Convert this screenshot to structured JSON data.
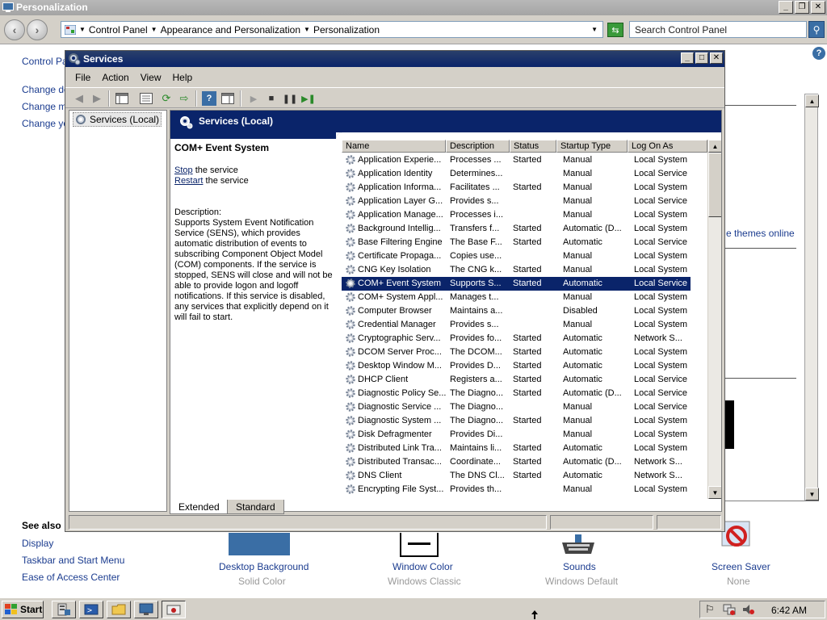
{
  "bg_window": {
    "title": "Personalization",
    "breadcrumb": [
      "Control Panel",
      "Appearance and Personalization",
      "Personalization"
    ],
    "search_placeholder": "Search Control Panel",
    "left_links": [
      "Control Panel Home",
      "Change desktop icons",
      "Change mouse pointers",
      "Change your account picture"
    ],
    "left_links_visible": [
      "Control Par",
      "Change de",
      "Change mo",
      "Change yo"
    ],
    "themes_link": "e themes online",
    "see_also": {
      "heading": "See also",
      "links": [
        "Display",
        "Taskbar and Start Menu",
        "Ease of Access Center"
      ]
    },
    "bottom_items": [
      {
        "label": "Desktop Background",
        "sub": "Solid Color"
      },
      {
        "label": "Window Color",
        "sub": "Windows Classic"
      },
      {
        "label": "Sounds",
        "sub": "Windows Default"
      },
      {
        "label": "Screen Saver",
        "sub": "None"
      }
    ]
  },
  "services": {
    "title": "Services",
    "menu": [
      "File",
      "Action",
      "View",
      "Help"
    ],
    "tree_node": "Services (Local)",
    "header": "Services (Local)",
    "selected_name": "COM+ Event System",
    "stop_link": "Stop",
    "stop_rest": " the service",
    "restart_link": "Restart",
    "restart_rest": " the service",
    "description_label": "Description:",
    "description": "Supports System Event Notification Service (SENS), which provides automatic distribution of events to subscribing Component Object Model (COM) components. If the service is stopped, SENS will close and will not be able to provide logon and logoff notifications. If this service is disabled, any services that explicitly depend on it will fail to start.",
    "columns": [
      "Name",
      "Description",
      "Status",
      "Startup Type",
      "Log On As"
    ],
    "rows": [
      [
        "Application Experie...",
        "Processes ...",
        "Started",
        "Manual",
        "Local System"
      ],
      [
        "Application Identity",
        "Determines...",
        "",
        "Manual",
        "Local Service"
      ],
      [
        "Application Informa...",
        "Facilitates ...",
        "Started",
        "Manual",
        "Local System"
      ],
      [
        "Application Layer G...",
        "Provides s...",
        "",
        "Manual",
        "Local Service"
      ],
      [
        "Application Manage...",
        "Processes i...",
        "",
        "Manual",
        "Local System"
      ],
      [
        "Background Intellig...",
        "Transfers f...",
        "Started",
        "Automatic (D...",
        "Local System"
      ],
      [
        "Base Filtering Engine",
        "The Base F...",
        "Started",
        "Automatic",
        "Local Service"
      ],
      [
        "Certificate Propaga...",
        "Copies use...",
        "",
        "Manual",
        "Local System"
      ],
      [
        "CNG Key Isolation",
        "The CNG k...",
        "Started",
        "Manual",
        "Local System"
      ],
      [
        "COM+ Event System",
        "Supports S...",
        "Started",
        "Automatic",
        "Local Service"
      ],
      [
        "COM+ System Appl...",
        "Manages t...",
        "",
        "Manual",
        "Local System"
      ],
      [
        "Computer Browser",
        "Maintains a...",
        "",
        "Disabled",
        "Local System"
      ],
      [
        "Credential Manager",
        "Provides s...",
        "",
        "Manual",
        "Local System"
      ],
      [
        "Cryptographic Serv...",
        "Provides fo...",
        "Started",
        "Automatic",
        "Network S..."
      ],
      [
        "DCOM Server Proc...",
        "The DCOM...",
        "Started",
        "Automatic",
        "Local System"
      ],
      [
        "Desktop Window M...",
        "Provides D...",
        "Started",
        "Automatic",
        "Local System"
      ],
      [
        "DHCP Client",
        "Registers a...",
        "Started",
        "Automatic",
        "Local Service"
      ],
      [
        "Diagnostic Policy Se...",
        "The Diagno...",
        "Started",
        "Automatic (D...",
        "Local Service"
      ],
      [
        "Diagnostic Service ...",
        "The Diagno...",
        "",
        "Manual",
        "Local Service"
      ],
      [
        "Diagnostic System ...",
        "The Diagno...",
        "Started",
        "Manual",
        "Local System"
      ],
      [
        "Disk Defragmenter",
        "Provides Di...",
        "",
        "Manual",
        "Local System"
      ],
      [
        "Distributed Link Tra...",
        "Maintains li...",
        "Started",
        "Automatic",
        "Local System"
      ],
      [
        "Distributed Transac...",
        "Coordinate...",
        "Started",
        "Automatic (D...",
        "Network S..."
      ],
      [
        "DNS Client",
        "The DNS Cl...",
        "Started",
        "Automatic",
        "Network S..."
      ],
      [
        "Encrypting File Syst...",
        "Provides th...",
        "",
        "Manual",
        "Local System"
      ]
    ],
    "selected_index": 9,
    "tabs": [
      "Extended",
      "Standard"
    ]
  },
  "taskbar": {
    "start_label": "Start",
    "clock": "6:42 AM"
  },
  "colors": {
    "title_active": "#0a246a",
    "selection": "#0a246a",
    "face": "#d4d0c8",
    "link": "#1b3c8f"
  }
}
